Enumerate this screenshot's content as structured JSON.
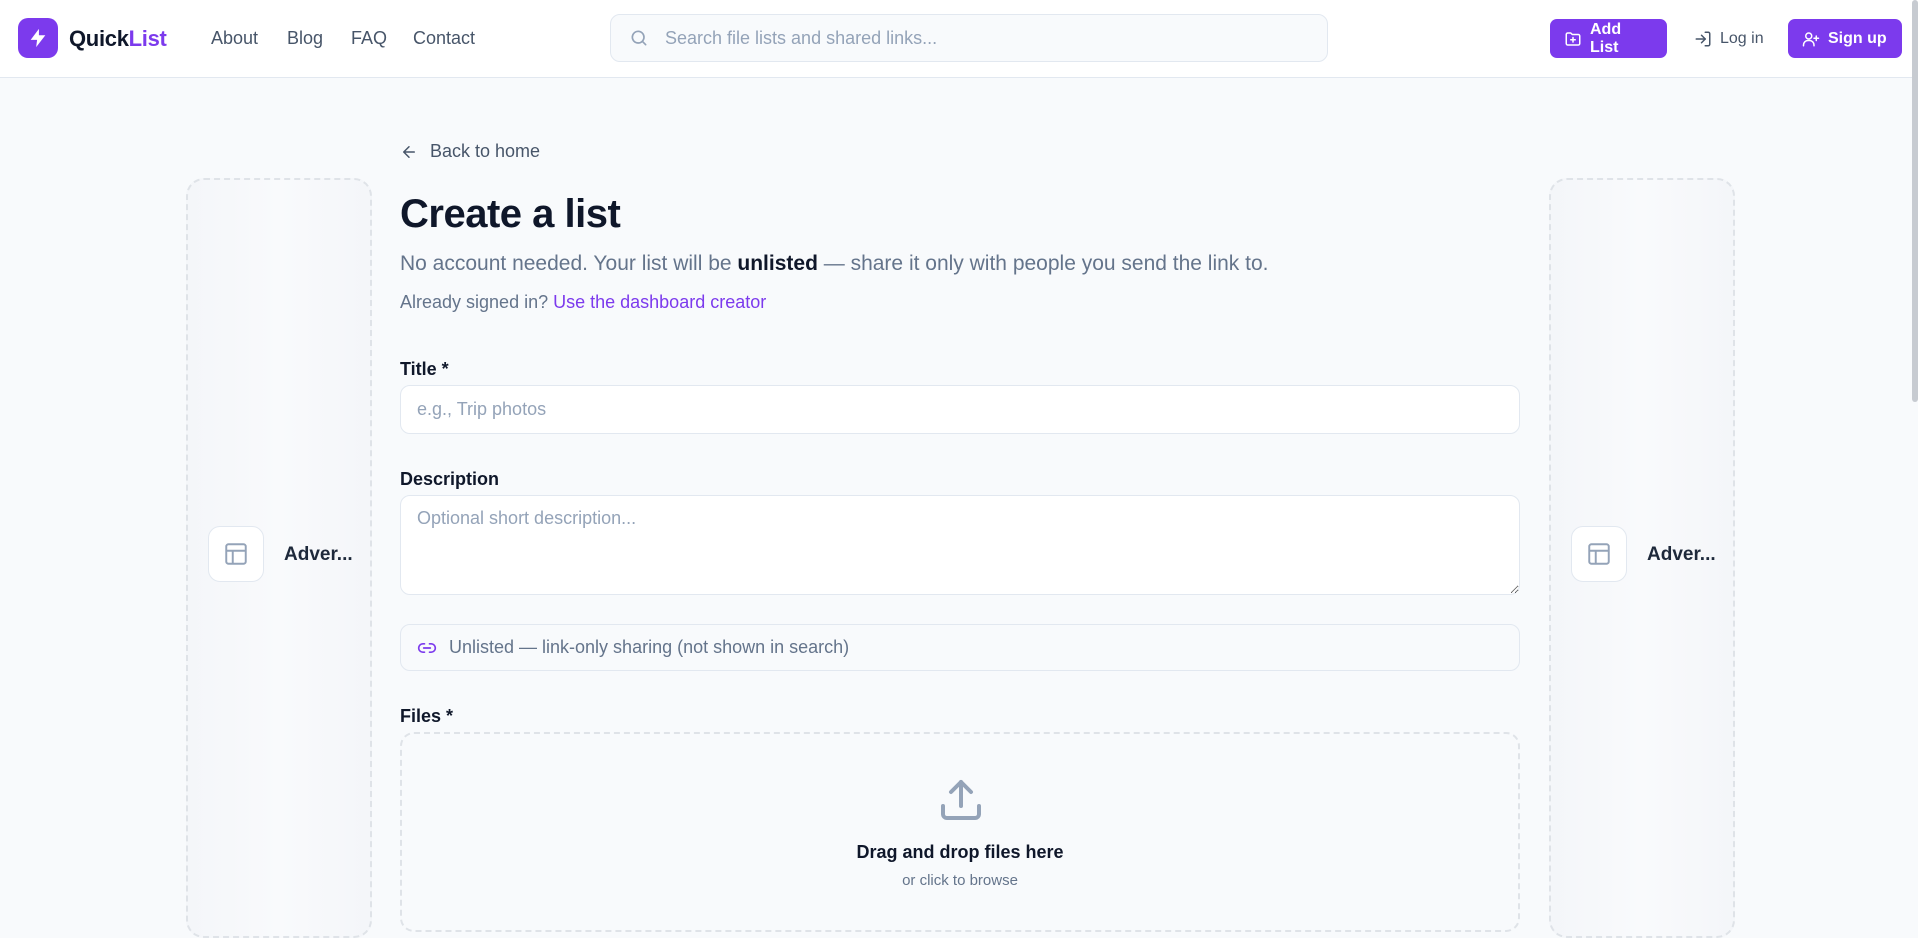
{
  "header": {
    "brand": {
      "part1": "Quick",
      "part2": "List"
    },
    "nav": [
      {
        "label": "About"
      },
      {
        "label": "Blog"
      },
      {
        "label": "FAQ"
      },
      {
        "label": "Contact"
      }
    ],
    "search_placeholder": "Search file lists and shared links...",
    "add_list_label": "Add List",
    "login_label": "Log in",
    "signup_label": "Sign up"
  },
  "ads": {
    "left_label": "Adver...",
    "right_label": "Adver..."
  },
  "main": {
    "back_label": "Back to home",
    "title": "Create a list",
    "subtitle_pre": "No account needed. Your list will be ",
    "subtitle_bold": "unlisted",
    "subtitle_post": " — share it only with people you send the link to.",
    "signed_in_text": "Already signed in? ",
    "dashboard_link": "Use the dashboard creator",
    "title_label": "Title *",
    "title_placeholder": "e.g., Trip photos",
    "description_label": "Description",
    "description_placeholder": "Optional short description...",
    "unlisted_note": "Unlisted — link-only sharing (not shown in search)",
    "files_label": "Files *",
    "drop_title": "Drag and drop files here",
    "drop_sub": "or click to browse"
  },
  "colors": {
    "accent": "#7c3aed",
    "background": "#f8fafc",
    "text": "#0f172a",
    "muted": "#64748b"
  },
  "icons": {
    "logo": "lightning-bolt-icon",
    "search": "search-icon",
    "add_list": "folder-plus-icon",
    "login": "login-icon",
    "signup": "user-plus-icon",
    "back": "arrow-left-icon",
    "ad": "layout-icon",
    "unlisted": "link-icon",
    "upload": "upload-icon"
  }
}
